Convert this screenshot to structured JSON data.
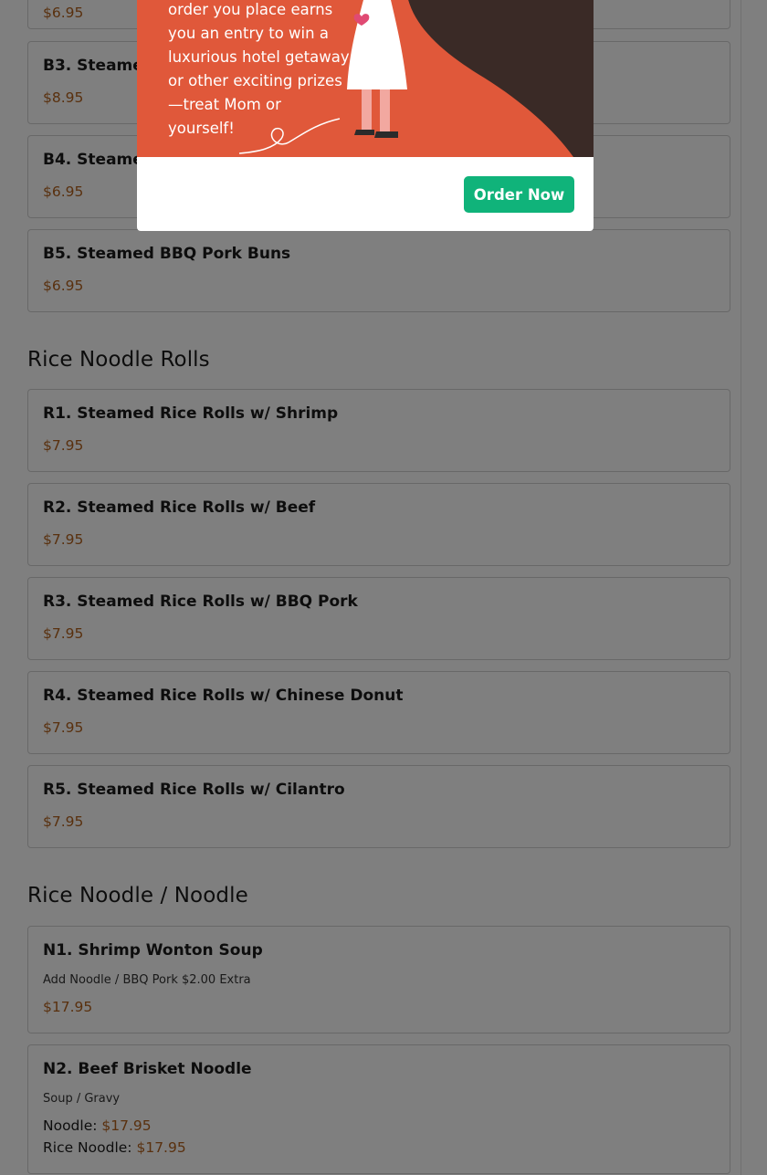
{
  "menu": {
    "top_partial": {
      "price": "$6.95"
    },
    "items_b": [
      {
        "name": "B3. Steamed",
        "price": "$8.95"
      },
      {
        "name": "B4. Steamed",
        "price": "$6.95"
      },
      {
        "name": "B5. Steamed BBQ Pork Buns",
        "price": "$6.95"
      }
    ],
    "rice_rolls": {
      "title": "Rice Noodle Rolls",
      "items": [
        {
          "name": "R1. Steamed Rice Rolls w/ Shrimp",
          "price": "$7.95"
        },
        {
          "name": "R2. Steamed Rice Rolls w/ Beef",
          "price": "$7.95"
        },
        {
          "name": "R3. Steamed Rice Rolls w/ BBQ Pork",
          "price": "$7.95"
        },
        {
          "name": "R4. Steamed Rice Rolls w/ Chinese Donut",
          "price": "$7.95"
        },
        {
          "name": "R5. Steamed Rice Rolls w/ Cilantro",
          "price": "$7.95"
        }
      ]
    },
    "noodles": {
      "title": "Rice Noodle / Noodle",
      "n1": {
        "name": "N1. Shrimp Wonton Soup",
        "desc": "Add Noodle / BBQ Pork $2.00 Extra",
        "price": "$17.95"
      },
      "n2": {
        "name": "N2. Beef Brisket Noodle",
        "desc": "Soup / Gravy",
        "options": [
          {
            "label": "Noodle:",
            "price": "$17.95"
          },
          {
            "label": "Rice Noodle:",
            "price": "$17.95"
          }
        ]
      }
    }
  },
  "modal": {
    "promo_lines": [
      "order you place earns",
      "you an entry to win a",
      "luxurious hotel getaway",
      "or other exciting prizes",
      "—treat Mom or",
      "yourself!"
    ],
    "order_button": "Order Now"
  },
  "colors": {
    "price": "#b3611c",
    "promo_bg": "#e0583a",
    "button": "#10b37a",
    "overlay": "rgba(0,0,0,0.5)"
  }
}
